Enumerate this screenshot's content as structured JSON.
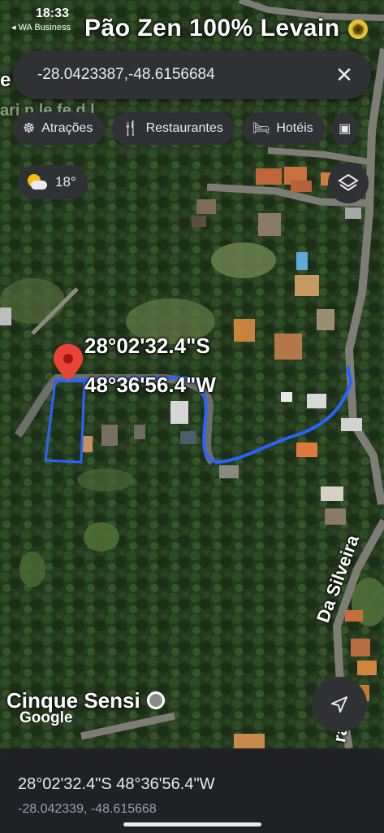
{
  "status_bar": {
    "time": "18:33",
    "back_app": "◂ WA Business"
  },
  "place_banner": {
    "name": "Pão Zen 100% Levain"
  },
  "search": {
    "query": "-28.0423387,-48.6156684",
    "clear_icon": "close-icon"
  },
  "chips": [
    {
      "label": "Atrações",
      "icon": "ferris-wheel-icon"
    },
    {
      "label": "Restaurantes",
      "icon": "fork-knife-icon"
    },
    {
      "label": "Hotéis",
      "icon": "bed-icon"
    },
    {
      "label": "",
      "icon": "more-chip-icon"
    }
  ],
  "weather": {
    "temp": "18°",
    "icon": "partly-cloudy-icon"
  },
  "map_labels": {
    "lat": "28°02'32.4\"S",
    "lng": "48°36'56.4\"W",
    "street_partial": "Da Silveira",
    "street_partial_2": "ra",
    "poi": "Cinque Sensi",
    "attribution": "Google",
    "top_left_partial": "e",
    "faded_label": "ari    n  le fe  d  l  "
  },
  "sheet": {
    "dms": "28°02'32.4\"S 48°36'56.4\"W",
    "decimal": "-28.042339, -48.615668"
  },
  "colors": {
    "chip_bg": "#303134",
    "sheet_bg": "#202124",
    "pin": "#ea4335",
    "measure_line": "#2962ff"
  }
}
